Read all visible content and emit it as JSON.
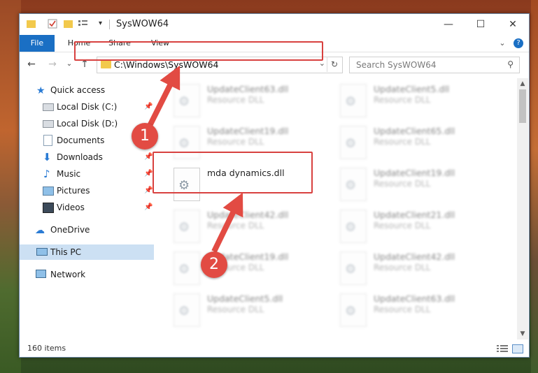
{
  "window": {
    "title": "SysWOW64",
    "minimize": "—",
    "maximize": "☐",
    "close": "✕"
  },
  "ribbon": {
    "tabs": [
      "File",
      "Home",
      "Share",
      "View"
    ],
    "expand": "⌄",
    "help": "?"
  },
  "nav": {
    "back": "←",
    "forward": "→",
    "recent": "⌄",
    "up": "↑"
  },
  "address": {
    "path": "C:\\Windows\\SysWOW64",
    "dropdown": "⌄",
    "refresh": "↻"
  },
  "search": {
    "placeholder": "Search SysWOW64",
    "icon": "⚲"
  },
  "sidebar": {
    "items": [
      {
        "label": "Quick access",
        "icon": "star-icon",
        "pinned": false
      },
      {
        "label": "Local Disk (C:)",
        "icon": "drive-icon",
        "pinned": true
      },
      {
        "label": "Local Disk (D:)",
        "icon": "drive-icon",
        "pinned": false
      },
      {
        "label": "Documents",
        "icon": "documents-icon",
        "pinned": true
      },
      {
        "label": "Downloads",
        "icon": "download-icon",
        "pinned": true
      },
      {
        "label": "Music",
        "icon": "music-icon",
        "pinned": true
      },
      {
        "label": "Pictures",
        "icon": "pictures-icon",
        "pinned": true
      },
      {
        "label": "Videos",
        "icon": "videos-icon",
        "pinned": true
      },
      {
        "label": "OneDrive",
        "icon": "cloud-icon",
        "pinned": false
      },
      {
        "label": "This PC",
        "icon": "pc-icon",
        "pinned": false,
        "selected": true
      },
      {
        "label": "Network",
        "icon": "network-icon",
        "pinned": false
      }
    ],
    "pin_glyph": "📌"
  },
  "files": {
    "left": [
      {
        "name": "UpdateClient63.dll",
        "type": "Resource DLL"
      },
      {
        "name": "UpdateClient19.dll",
        "type": "Resource DLL"
      },
      {
        "name": "mda dynamics.dll",
        "type": ""
      },
      {
        "name": "UpdateClient42.dll",
        "type": "Resource DLL"
      },
      {
        "name": "UpdateClient19.dll",
        "type": "Resource DLL"
      },
      {
        "name": "UpdateClient5.dll",
        "type": "Resource DLL"
      }
    ],
    "right": [
      {
        "name": "UpdateClient5.dll",
        "type": "Resource DLL"
      },
      {
        "name": "UpdateClient65.dll",
        "type": "Resource DLL"
      },
      {
        "name": "UpdateClient19.dll",
        "type": "Resource DLL"
      },
      {
        "name": "UpdateClient21.dll",
        "type": "Resource DLL"
      },
      {
        "name": "UpdateClient42.dll",
        "type": "Resource DLL"
      },
      {
        "name": "UpdateClient63.dll",
        "type": "Resource DLL"
      }
    ]
  },
  "status": {
    "item_count": "160 items"
  },
  "annotations": {
    "badge1": "1",
    "badge2": "2",
    "color": "#e24b43"
  }
}
